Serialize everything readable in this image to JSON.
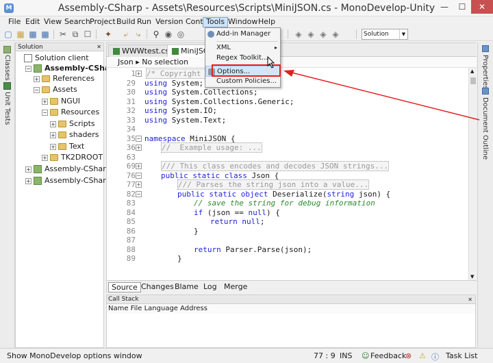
{
  "window": {
    "title": "Assembly-CSharp - Assets\\Resources\\Scripts\\MiniJSON.cs - MonoDevelop-Unity",
    "min": "—",
    "max": "☐",
    "close": "✕"
  },
  "menubar": [
    "File",
    "Edit",
    "View",
    "Search",
    "Project",
    "Build",
    "Run",
    "Version Control",
    "Tools",
    "Window",
    "Help"
  ],
  "toolbar": {
    "solution_combo": "Solution"
  },
  "left_strip": {
    "tab1": "Classes",
    "tab2": "Unit Tests"
  },
  "solution_pad": {
    "title": "Solution",
    "close": "✕",
    "items": [
      "Solution client",
      "Assembly-CSharp",
      "References",
      "Assets",
      "NGUI",
      "Resources",
      "Scripts",
      "shaders",
      "Text",
      "TK2DROOT",
      "Assembly-CSharp-E",
      "Assembly-CSharp-fi"
    ]
  },
  "editor": {
    "tabs": [
      "WWWtest.cs",
      "MiniJSON"
    ],
    "breadcrumb_class": "Json",
    "breadcrumb_member": "No selection",
    "line_numbers": [
      "1",
      "29",
      "30",
      "31",
      "32",
      "33",
      "34",
      "35",
      "36",
      "63",
      "69",
      "76",
      "77",
      "82",
      "83",
      "84",
      "85",
      "86",
      "87",
      "88",
      "89"
    ],
    "code": {
      "l1": "/* Copyright (c)",
      "l1b": "*/",
      "l29_kw": "using",
      "l29": " System;",
      "l30_kw": "using",
      "l30": " System.Collections;",
      "l31_kw": "using",
      "l31": " System.Collections.Generic;",
      "l32_kw": "using",
      "l32": " System.IO;",
      "l33_kw": "using",
      "l33": " System.Text;",
      "l35_kw": "namespace",
      "l35": " MiniJSON {",
      "l36": "//  Example usage: ...",
      "l69": "/// This class encodes and decodes JSON strings...",
      "l76_kw": "public static class",
      "l76": " Json {",
      "l77": "/// Parses the string json into a value...",
      "l82_kw1": "public static object",
      "l82a": " Deserialize(",
      "l82_kw2": "string",
      "l82b": " json) {",
      "l83": "// save the string for debug information",
      "l84_kw": "if",
      "l84a": " (json == ",
      "l84_null": "null",
      "l84b": ") {",
      "l85_kw": "return",
      "l85_null": "null",
      "l85b": ";",
      "l86": "}",
      "l88_kw": "return",
      "l88": " Parser.Parse(json);",
      "l89": "}"
    },
    "view_tabs": [
      "Source",
      "Changes",
      "Blame",
      "Log",
      "Merge"
    ]
  },
  "callstack": {
    "title": "Call Stack",
    "columns": "Name File Language Address",
    "close": "✕"
  },
  "right_strip": {
    "tab1": "Properties",
    "tab2": "Document Outline"
  },
  "statusbar": {
    "message": "Show MonoDevelop options window",
    "position": "77 : 9",
    "mode": "INS",
    "feedback": "Feedback",
    "tasklist": "Task List"
  },
  "tools_menu": {
    "items": [
      "Add-in Manager",
      "XML",
      "Regex Toolkit...",
      "Options...",
      "Custom Policies..."
    ],
    "submenu_arrow": "▸"
  },
  "colors": {
    "highlight_box": "#e02020",
    "arrow": "#e02020",
    "keyword": "#1e1ee0",
    "comment": "#2a8a2a"
  }
}
